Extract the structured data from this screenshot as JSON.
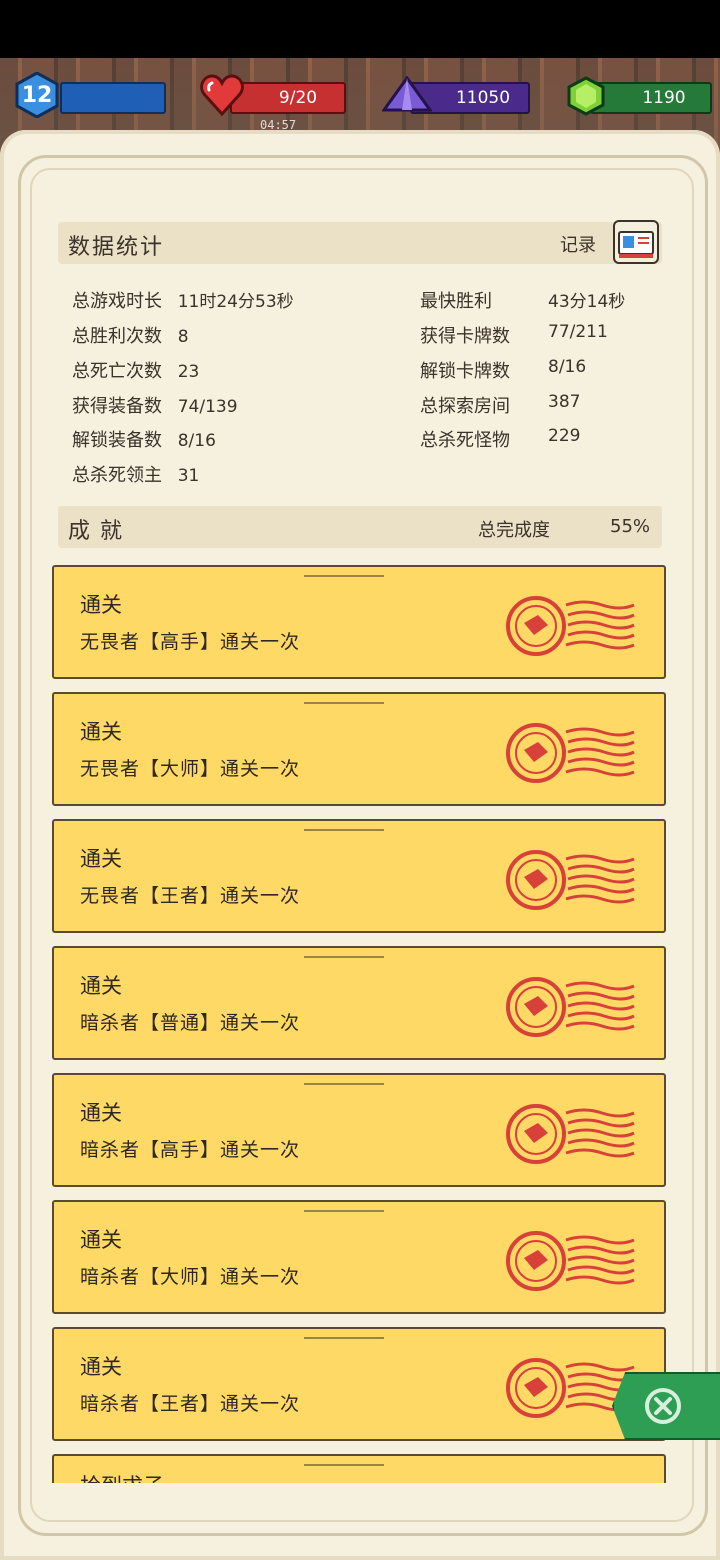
{
  "topbar": {
    "level": "12",
    "hp": "9/20",
    "crystals": "11050",
    "gems": "1190",
    "timer": "04:57"
  },
  "stats": {
    "title": "数据统计",
    "record_label": "记录",
    "left": [
      {
        "label": "总游戏时长",
        "value": "11时24分53秒"
      },
      {
        "label": "总胜利次数",
        "value": "8"
      },
      {
        "label": "总死亡次数",
        "value": "23"
      },
      {
        "label": "获得装备数",
        "value": "74/139"
      },
      {
        "label": "解锁装备数",
        "value": "8/16"
      },
      {
        "label": "总杀死领主",
        "value": "31"
      }
    ],
    "right": [
      {
        "label": "最快胜利",
        "value": "43分14秒"
      },
      {
        "label": "获得卡牌数",
        "value": "77/211"
      },
      {
        "label": "解锁卡牌数",
        "value": "8/16"
      },
      {
        "label": "总探索房间",
        "value": "387"
      },
      {
        "label": "总杀死怪物",
        "value": "229"
      }
    ]
  },
  "achievements": {
    "title": "成就",
    "progress_label": "总完成度",
    "progress_value": "55%",
    "items": [
      {
        "title": "通关",
        "desc": "无畏者【高手】通关一次"
      },
      {
        "title": "通关",
        "desc": "无畏者【大师】通关一次"
      },
      {
        "title": "通关",
        "desc": "无畏者【王者】通关一次"
      },
      {
        "title": "通关",
        "desc": "暗杀者【普通】通关一次"
      },
      {
        "title": "通关",
        "desc": "暗杀者【高手】通关一次"
      },
      {
        "title": "通关",
        "desc": "暗杀者【大师】通关一次"
      },
      {
        "title": "通关",
        "desc": "暗杀者【王者】通关一次"
      },
      {
        "title": "拾到求子",
        "desc": ""
      }
    ]
  },
  "colors": {
    "card": "#ffd966",
    "stamp": "#d8403a",
    "close_tab": "#2e9e55"
  }
}
